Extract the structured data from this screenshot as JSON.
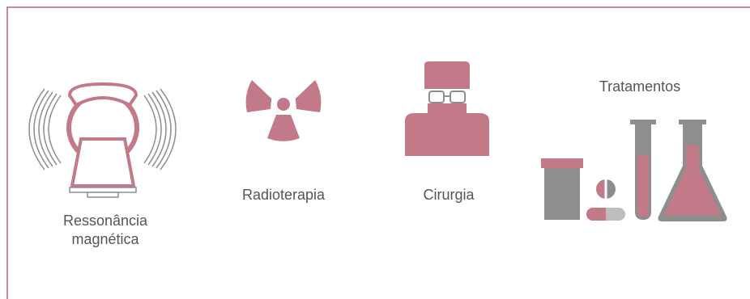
{
  "colors": {
    "rose": "#c27a89",
    "gray": "#8e8e8f",
    "light_gray": "#bdbdbd",
    "frame": "#c88a99",
    "text": "#555555"
  },
  "items": [
    {
      "id": "mri",
      "icon": "mri-scanner-icon",
      "label_line1": "Ressonância",
      "label_line2": "magnética"
    },
    {
      "id": "radiotherapy",
      "icon": "radiation-icon",
      "label": "Radioterapia"
    },
    {
      "id": "surgery",
      "icon": "surgeon-icon",
      "label": "Cirurgia"
    },
    {
      "id": "treatments",
      "icon": "lab-treatments-icon",
      "label": "Tratamentos"
    }
  ]
}
